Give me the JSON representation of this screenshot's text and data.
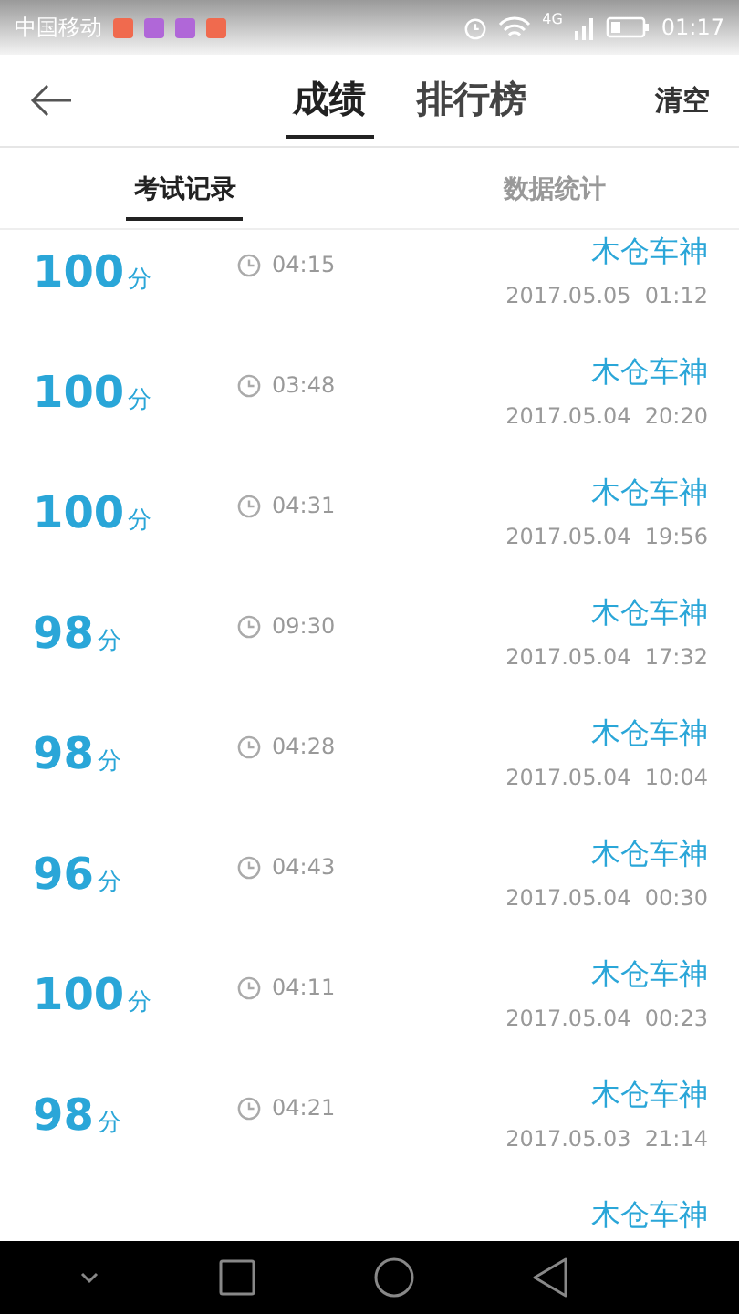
{
  "status_bar": {
    "carrier": "中国移动",
    "network": "4G",
    "time": "01:17",
    "app_icons": [
      {
        "color": "#f06a4e"
      },
      {
        "color": "#b067d8"
      },
      {
        "color": "#b067d8"
      },
      {
        "color": "#f06a4e"
      }
    ]
  },
  "header": {
    "tabs": [
      {
        "label": "成绩",
        "selected": true
      },
      {
        "label": "排行榜",
        "selected": false
      }
    ],
    "action": "清空"
  },
  "subtabs": [
    {
      "label": "考试记录",
      "selected": true
    },
    {
      "label": "数据统计",
      "selected": false
    }
  ],
  "records": [
    {
      "score": "100",
      "unit": "分",
      "duration": "04:15",
      "name": "木仓车神",
      "date": "2017.05.05  01:12"
    },
    {
      "score": "100",
      "unit": "分",
      "duration": "03:48",
      "name": "木仓车神",
      "date": "2017.05.04  20:20"
    },
    {
      "score": "100",
      "unit": "分",
      "duration": "04:31",
      "name": "木仓车神",
      "date": "2017.05.04  19:56"
    },
    {
      "score": "98",
      "unit": "分",
      "duration": "09:30",
      "name": "木仓车神",
      "date": "2017.05.04  17:32"
    },
    {
      "score": "98",
      "unit": "分",
      "duration": "04:28",
      "name": "木仓车神",
      "date": "2017.05.04  10:04"
    },
    {
      "score": "96",
      "unit": "分",
      "duration": "04:43",
      "name": "木仓车神",
      "date": "2017.05.04  00:30"
    },
    {
      "score": "100",
      "unit": "分",
      "duration": "04:11",
      "name": "木仓车神",
      "date": "2017.05.04  00:23"
    },
    {
      "score": "98",
      "unit": "分",
      "duration": "04:21",
      "name": "木仓车神",
      "date": "2017.05.03  21:14"
    },
    {
      "name": "木仓车神"
    }
  ]
}
